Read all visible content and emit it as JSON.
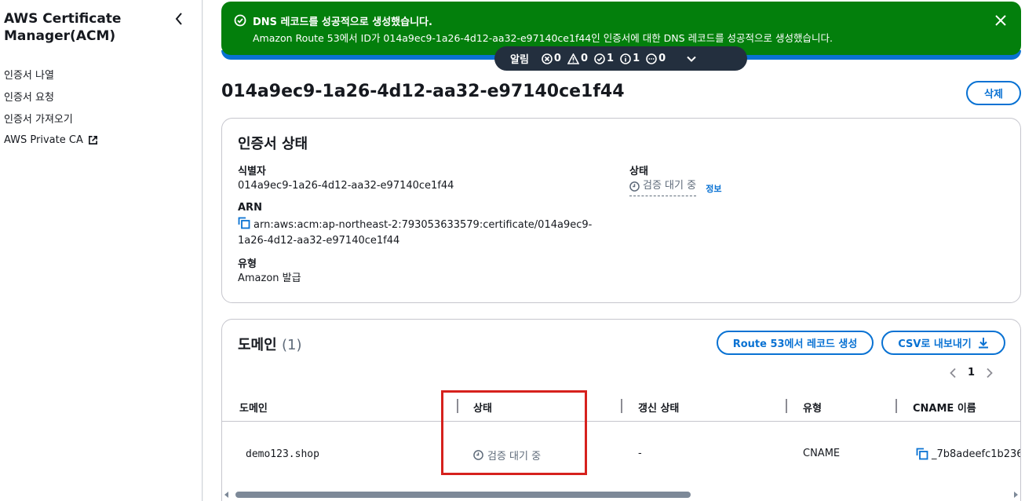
{
  "sidebar": {
    "title": "AWS Certificate Manager(ACM)",
    "items": [
      {
        "label": "인증서 나열"
      },
      {
        "label": "인증서 요청"
      },
      {
        "label": "인증서 가져오기"
      },
      {
        "label": "AWS Private CA"
      }
    ]
  },
  "flash": {
    "title": "DNS 레코드를 성공적으로 생성했습니다.",
    "message": "Amazon Route 53에서 ID가 014a9ec9-1a26-4d12-aa32-e97140ce1f44인 인증서에 대한 DNS 레코드를 성공적으로 생성했습니다.",
    "color": "#037f0c"
  },
  "notifications": {
    "label": "알림",
    "error_count": "0",
    "warning_count": "0",
    "success_count": "1",
    "info_count": "1",
    "progress_count": "0"
  },
  "page": {
    "title": "014a9ec9-1a26-4d12-aa32-e97140ce1f44",
    "delete_label": "삭제"
  },
  "certificate_status": {
    "heading": "인증서 상태",
    "identifier_label": "식별자",
    "identifier_value": "014a9ec9-1a26-4d12-aa32-e97140ce1f44",
    "status_label": "상태",
    "status_value": "검증 대기 중",
    "info_link": "정보",
    "arn_label": "ARN",
    "arn_line1": "arn:aws:acm:ap-northeast-2:793053633579:certificate/014a9ec9-",
    "arn_line2": "1a26-4d12-aa32-e97140ce1f44",
    "type_label": "유형",
    "type_value": "Amazon 발급"
  },
  "domains": {
    "heading": "도메인",
    "count": "(1)",
    "route53_button": "Route 53에서 레코드 생성",
    "csv_button": "CSV로 내보내기",
    "page_number": "1",
    "columns": [
      "도메인",
      "상태",
      "갱신 상태",
      "유형",
      "CNAME 이름"
    ],
    "rows": [
      {
        "domain": "demo123.shop",
        "status": "검증 대기 중",
        "renewal_status": "-",
        "type": "CNAME",
        "cname_name": "_7b8adeefc1b236"
      }
    ]
  }
}
